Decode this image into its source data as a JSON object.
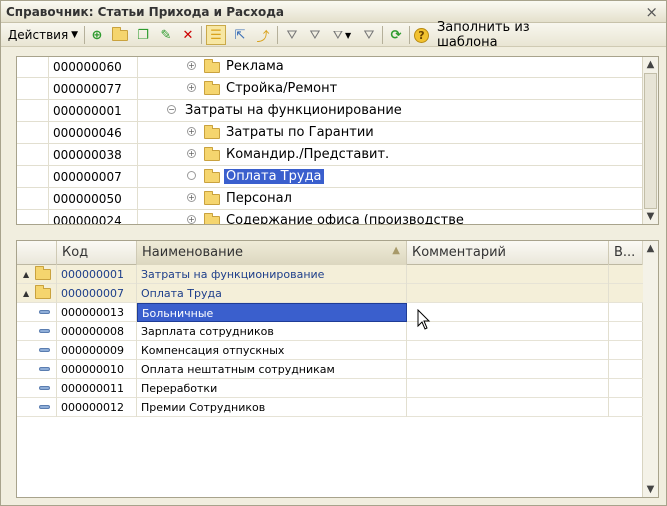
{
  "window": {
    "title": "Справочник: Статьи Прихода и Расхода",
    "close_glyph": "×"
  },
  "toolbar": {
    "actions_label": "Действия",
    "fill_template_label": "Заполнить из шаблона",
    "icons": [
      "add-icon",
      "add-folder-icon",
      "copy-icon",
      "edit-icon",
      "delete-icon",
      "hierarchy-icon",
      "move-icon",
      "move-to-group-icon",
      "filter-icon",
      "filter-value-icon",
      "filter-list-icon",
      "filter-clear-icon",
      "refresh-icon",
      "help-icon"
    ]
  },
  "tree": {
    "rows": [
      {
        "code": "000000060",
        "name": "Реклама",
        "level": 2,
        "expander": "plus",
        "folder": true,
        "selected": false
      },
      {
        "code": "000000077",
        "name": "Стройка/Ремонт",
        "level": 2,
        "expander": "plus",
        "folder": true,
        "selected": false
      },
      {
        "code": "000000001",
        "name": "Затраты на функционирование",
        "level": 1,
        "expander": "minus",
        "folder": false,
        "selected": false
      },
      {
        "code": "000000046",
        "name": "Затраты по Гарантии",
        "level": 2,
        "expander": "plus",
        "folder": true,
        "selected": false
      },
      {
        "code": "000000038",
        "name": "Командир./Представит.",
        "level": 2,
        "expander": "plus",
        "folder": true,
        "selected": false
      },
      {
        "code": "000000007",
        "name": "Оплата Труда",
        "level": 2,
        "expander": "empty",
        "folder": true,
        "selected": true
      },
      {
        "code": "000000050",
        "name": "Персонал",
        "level": 2,
        "expander": "plus",
        "folder": true,
        "selected": false
      },
      {
        "code": "000000024",
        "name": "Содержание офиса (производстве",
        "level": 2,
        "expander": "plus",
        "folder": true,
        "selected": false
      }
    ]
  },
  "grid": {
    "columns": {
      "code": "Код",
      "name": "Наименование",
      "comment": "Комментарий",
      "extra": "В..."
    },
    "rows": [
      {
        "type": "group",
        "code": "000000001",
        "name": "Затраты на функционирование",
        "comment": "",
        "selected": false
      },
      {
        "type": "group",
        "code": "000000007",
        "name": "Оплата Труда",
        "comment": "",
        "selected": false
      },
      {
        "type": "item",
        "code": "000000013",
        "name": "Больничные",
        "comment": "",
        "selected": true
      },
      {
        "type": "item",
        "code": "000000008",
        "name": "Зарплата сотрудников",
        "comment": "",
        "selected": false
      },
      {
        "type": "item",
        "code": "000000009",
        "name": "Компенсация отпускных",
        "comment": "",
        "selected": false
      },
      {
        "type": "item",
        "code": "000000010",
        "name": "Оплата нештатным сотрудникам",
        "comment": "",
        "selected": false
      },
      {
        "type": "item",
        "code": "000000011",
        "name": "Переработки",
        "comment": "",
        "selected": false
      },
      {
        "type": "item",
        "code": "000000012",
        "name": "Премии Сотрудников",
        "comment": "",
        "selected": false
      }
    ]
  },
  "colors": {
    "selection": "#3A5FCD",
    "group_row": "#F4EFD9",
    "group_text": "#1D3E8A"
  }
}
